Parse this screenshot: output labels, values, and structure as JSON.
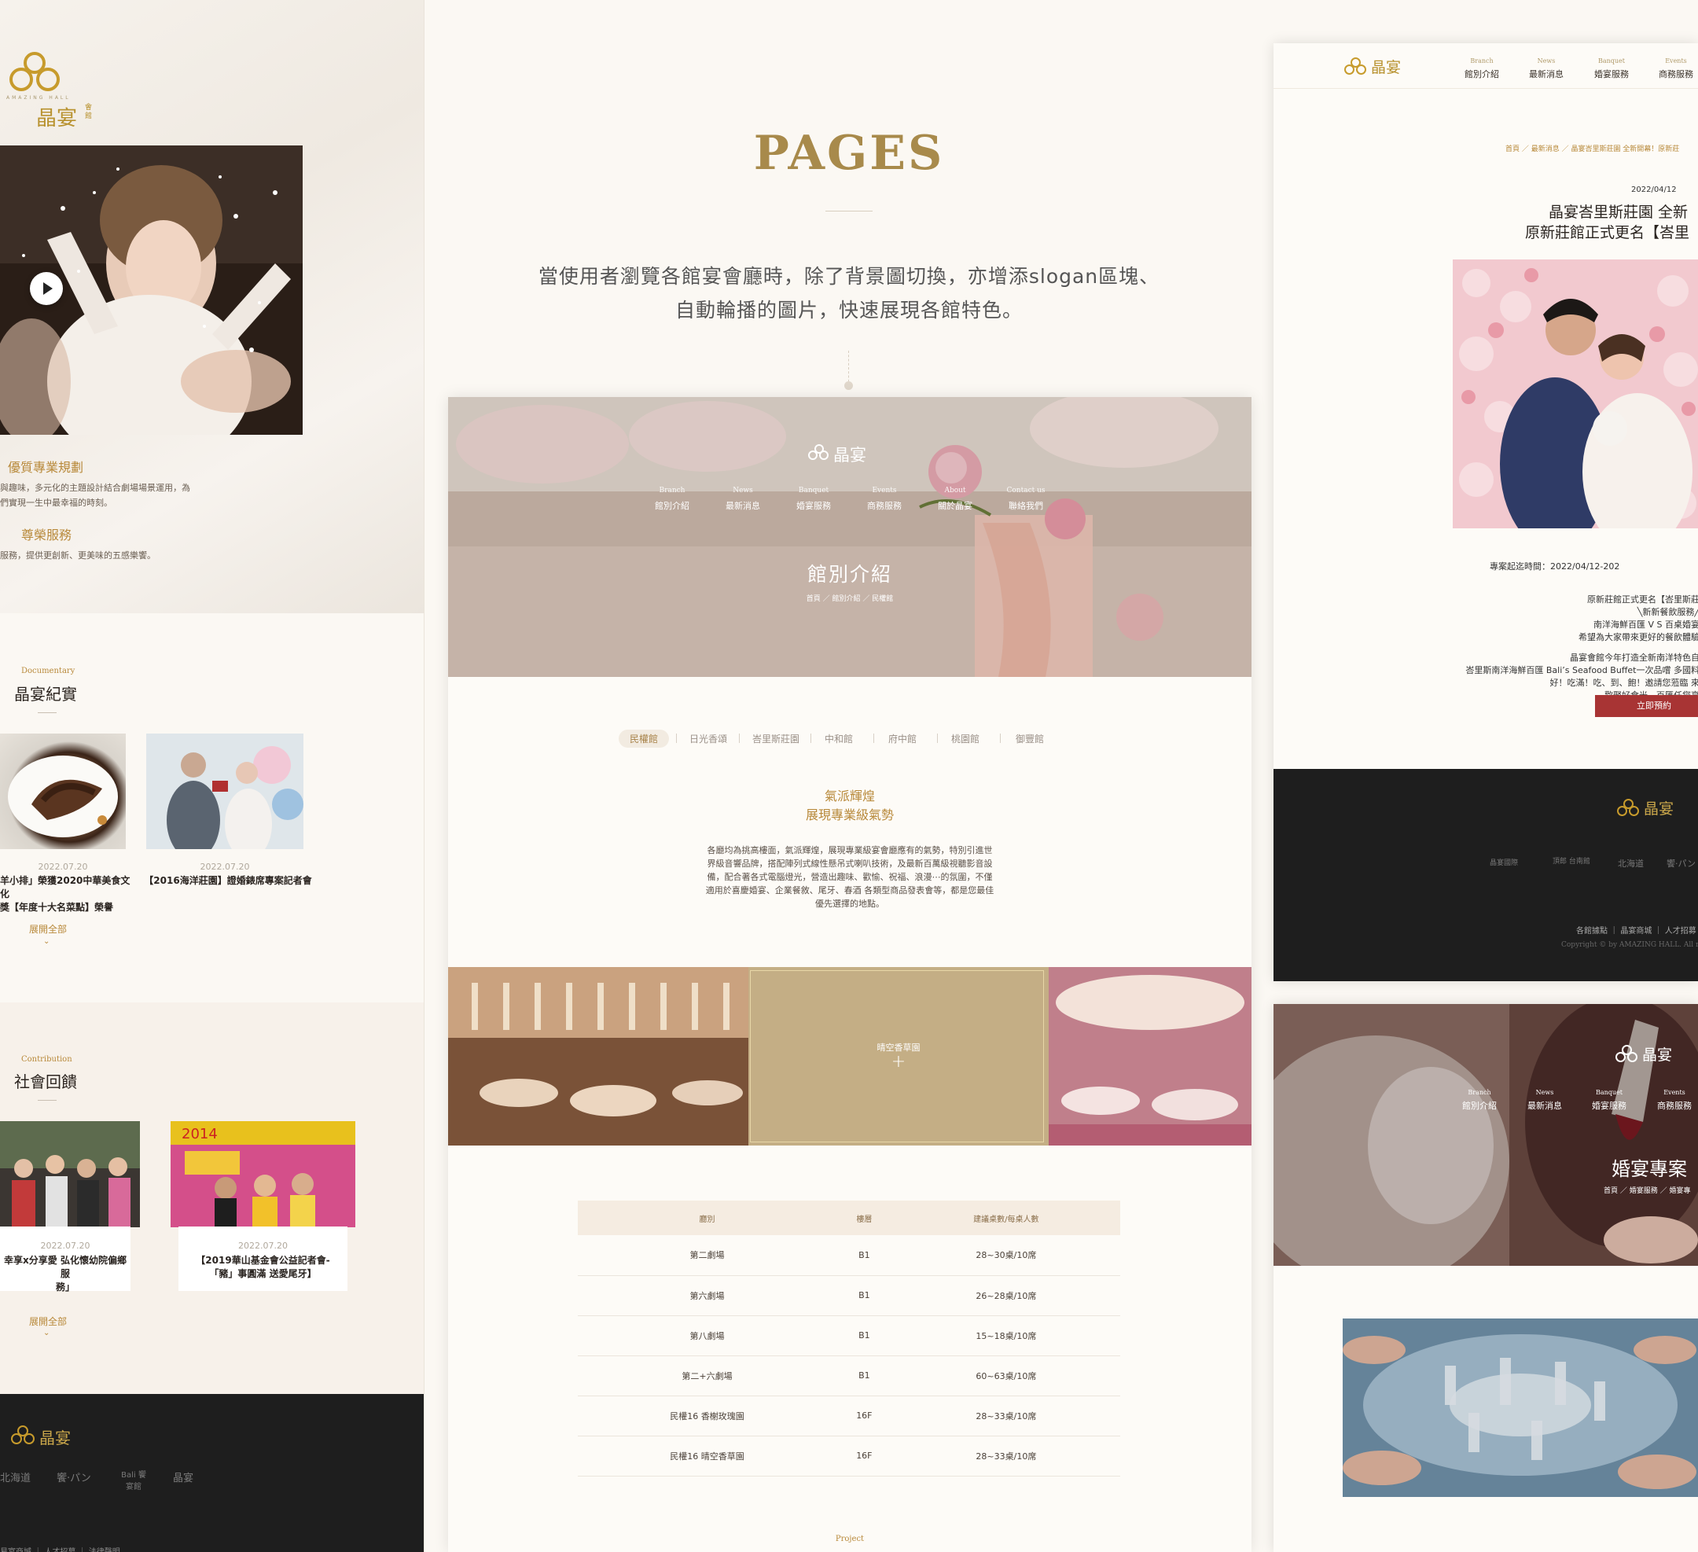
{
  "colors": {
    "gold": "#b8893a",
    "gold_title": "#a88a4b",
    "dark_footer": "#1e1e1e",
    "cta_red": "#a83434",
    "table_header": "#f5ece1"
  },
  "brand": {
    "name_zh": "晶宴",
    "name_small": "會館",
    "name_en": "AMAZING HALL"
  },
  "left": {
    "feature1_title": "優質專業規劃",
    "feature1_text_1": "與趣味，多元化的主題設計結合劇場場景運用，為",
    "feature1_text_2": "們實現一生中最幸福的時刻。",
    "feature2_title": "尊榮服務",
    "feature2_text": "服務，提供更創新、更美味的五感樂饗。",
    "documentary_en": "Documentary",
    "documentary_zh": "晶宴紀實",
    "doc_cards": [
      {
        "date": "2022.07.20",
        "title_1": "羊小排」榮獲2020中華美食文化",
        "title_2": "獎【年度十大名菜點】榮譽"
      },
      {
        "date": "2022.07.20",
        "title_1": "【2016海洋莊園】證婚錶席專案記者會",
        "title_2": ""
      }
    ],
    "expand_all": "展開全部",
    "contribution_en": "Contribution",
    "contribution_zh": "社會回饋",
    "contrib_cards": [
      {
        "date": "2022.07.20",
        "title_1": "幸享x分享愛 弘化懷幼院偏鄉服",
        "title_2": "務」"
      },
      {
        "date": "2022.07.20",
        "title_1": "【2019華山基金會公益記者會-",
        "title_2": "「豬」事圓滿 送愛尾牙】"
      }
    ],
    "poster_text": "2014",
    "footer_links": "易宴商城 ｜ 人才招募 ｜ 法律聲明",
    "partner_logos": [
      "北海道",
      "饗·パン",
      "Bali 饗宴館",
      "晶宴"
    ]
  },
  "center": {
    "title": "PAGES",
    "desc_1": "當使用者瀏覽各館宴會廳時，除了背景圖切換，亦增添slogan區塊、",
    "desc_2": "自動輪播的圖片，快速展現各館特色。",
    "nav": [
      {
        "en": "Branch",
        "zh": "館別介紹"
      },
      {
        "en": "News",
        "zh": "最新消息"
      },
      {
        "en": "Banquet",
        "zh": "婚宴服務"
      },
      {
        "en": "Events",
        "zh": "商務服務"
      },
      {
        "en": "About",
        "zh": "關於晶宴"
      },
      {
        "en": "Contact us",
        "zh": "聯絡我們"
      }
    ],
    "banner_title": "館別介紹",
    "breadcrumb": "首頁 ／ 館別介紹 ／ 民權館",
    "tabs": [
      "民權館",
      "日光香頌",
      "峇里斯莊園",
      "中和館",
      "府中館",
      "桃園館",
      "御豐館"
    ],
    "slogan_1": "氣派輝煌",
    "slogan_2": "展現專業級氣勢",
    "body_1": "各廳均為挑高樓面，氣派輝煌，展現專業級宴會廳應有的氣勢，特別引進世",
    "body_2": "界級音響品牌，搭配陣列式線性懸吊式喇叭技術，及最新百萬級視聽影音設",
    "body_3": "備，配合著各式電腦燈光，營造出趣味、歡愉、祝福、浪漫⋯的氛圍，不僅",
    "body_4": "適用於喜慶婚宴、企業餐敘、尾牙、春酒 各類型商品發表會等，都是您最佳",
    "body_5": "優先選擇的地點。",
    "venue_overlay": "晴空香草園",
    "plus": "+",
    "table_headers": [
      "廳別",
      "樓層",
      "建議桌數/每桌人數"
    ],
    "table_rows": [
      [
        "第二劇場",
        "B1",
        "28~30桌/10席"
      ],
      [
        "第六劇場",
        "B1",
        "26~28桌/10席"
      ],
      [
        "第八劇場",
        "B1",
        "15~18桌/10席"
      ],
      [
        "第二+六劇場",
        "B1",
        "60~63桌/10席"
      ],
      [
        "民權16 香榭玫瑰園",
        "16F",
        "28~33桌/10席"
      ],
      [
        "民權16 晴空香草園",
        "16F",
        "28~33桌/10席"
      ]
    ],
    "project_label": "Project"
  },
  "right": {
    "nav": [
      {
        "en": "Branch",
        "zh": "館別介紹"
      },
      {
        "en": "News",
        "zh": "最新消息"
      },
      {
        "en": "Banquet",
        "zh": "婚宴服務"
      },
      {
        "en": "Events",
        "zh": "商務服務"
      }
    ],
    "breadcrumb": "首頁 ／ 最新消息 ／ 晶宴峇里斯莊園 全新開幕！原新莊",
    "date": "2022/04/12",
    "news_title_1": "晶宴峇里斯莊園 全新",
    "news_title_2": "原新莊館正式更名【峇里",
    "period": "專案起迄時間：2022/04/12-202",
    "p1": "原新莊館正式更名【峇里斯莊",
    "p2": "╲新新餐飲服務╱",
    "p3": "南洋海鮮百匯 V S 百桌婚宴",
    "p4": "希望為大家帶來更好的餐飲體驗",
    "p5": "晶宴會館今年打造全新南洋特色自",
    "p6": "峇里斯南洋海鮮百匯 Bali’s Seafood Buffet一次品嚐 多國料",
    "p7": "好！吃滿！吃、到、飽！邀請您蒞臨 來",
    "p8": "-歡聚好食光，百匯任您享",
    "cta": "立即預約",
    "footer_links": "各館據點 ｜ 晶宴商城 ｜ 人才招募 ｜",
    "copyright": "Copyright © by AMAZING HALL. All ri",
    "footer_logos": [
      "晶宴國際",
      "頂郎 台南館",
      "北海道",
      "饗·パン"
    ],
    "banner2_title": "婚宴專案",
    "banner2_breadcrumb": "首頁 ／ 婚宴服務 ／ 婚宴專"
  }
}
